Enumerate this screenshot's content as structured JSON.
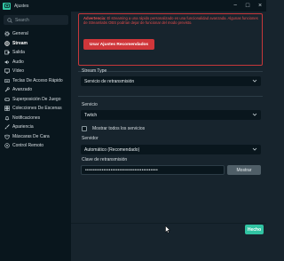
{
  "window": {
    "title": "Ajustes",
    "minimize": "−",
    "maximize": "□",
    "close": "×"
  },
  "sidebar": {
    "search_placeholder": "Search",
    "items": [
      {
        "label": "General",
        "icon": "gear-icon"
      },
      {
        "label": "Stream",
        "icon": "globe-icon",
        "active": true
      },
      {
        "label": "Salida",
        "icon": "output-icon"
      },
      {
        "label": "Audio",
        "icon": "speaker-icon"
      },
      {
        "label": "Vídeo",
        "icon": "monitor-icon"
      },
      {
        "label": "Teclas De Acceso Rápido",
        "icon": "keyboard-icon"
      },
      {
        "label": "Avanzado",
        "icon": "wrench-icon"
      },
      {
        "label": "Superposición De Juego",
        "icon": "gamepad-icon"
      },
      {
        "label": "Colecciones De Escenas",
        "icon": "collection-icon"
      },
      {
        "label": "Notificaciones",
        "icon": "bell-icon"
      },
      {
        "label": "Apariencia",
        "icon": "brush-icon"
      },
      {
        "label": "Máscaras De Cara",
        "icon": "mask-icon"
      },
      {
        "label": "Control Remoto",
        "icon": "remote-icon"
      }
    ]
  },
  "warning": {
    "prefix": "Advertencia:",
    "text": " El streaming a una rápido personalizado es una funcionalidad avanzada. Algunas funciones de Streamlabs OBS podrían dejar de funcionar del modo previsto.",
    "button_label": "Usar Ajustes Recomendados"
  },
  "stream_type": {
    "label": "Stream Type",
    "value": "Servicio de retransmisión"
  },
  "service": {
    "label": "Servicio",
    "value": "Twitch",
    "show_all_label": "Mostrar todos los servicios"
  },
  "server": {
    "label": "Servidor",
    "value": "Automático (Recomendado)"
  },
  "stream_key": {
    "label": "Clave de retransmisión",
    "value": "••••••••••••••••••••••••••••••••••••••••",
    "show_button": "Mostrar"
  },
  "footer": {
    "done_label": "Hecho"
  },
  "colors": {
    "accent": "#31c3a2",
    "warning": "#d0363a",
    "sidebar_bg": "#09161d",
    "content_bg": "#17242d"
  }
}
